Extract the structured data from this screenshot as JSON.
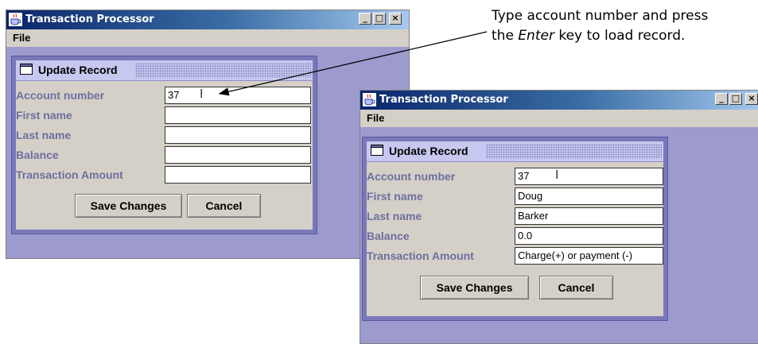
{
  "callout": {
    "line1": "Type account number and press",
    "line2_prefix": "the ",
    "line2_emph": "Enter",
    "line2_suffix": " key to load record."
  },
  "windows": [
    {
      "title": "Transaction Processor",
      "menu": "File",
      "frame_title": "Update Record",
      "fields": [
        {
          "label": "Account number",
          "value": "37"
        },
        {
          "label": "First name",
          "value": ""
        },
        {
          "label": "Last name",
          "value": ""
        },
        {
          "label": "Balance",
          "value": ""
        },
        {
          "label": "Transaction Amount",
          "value": ""
        }
      ],
      "buttons": {
        "save": "Save Changes",
        "cancel": "Cancel"
      }
    },
    {
      "title": "Transaction Processor",
      "menu": "File",
      "frame_title": "Update Record",
      "fields": [
        {
          "label": "Account number",
          "value": "37"
        },
        {
          "label": "First name",
          "value": "Doug"
        },
        {
          "label": "Last name",
          "value": "Barker"
        },
        {
          "label": "Balance",
          "value": "0.0"
        },
        {
          "label": "Transaction Amount",
          "value": "Charge(+) or payment (-)"
        }
      ],
      "buttons": {
        "save": "Save Changes",
        "cancel": "Cancel"
      }
    }
  ],
  "window_buttons": {
    "minimize": "_",
    "maximize": "□",
    "close": "×"
  },
  "icons": {
    "app": "java-cup-icon",
    "frame": "internal-frame-icon",
    "cursor": "text-cursor-icon"
  },
  "colors": {
    "title_gradient_start": "#0a246a",
    "desktop": "#9d9bcd",
    "label": "#6e6e9e"
  }
}
